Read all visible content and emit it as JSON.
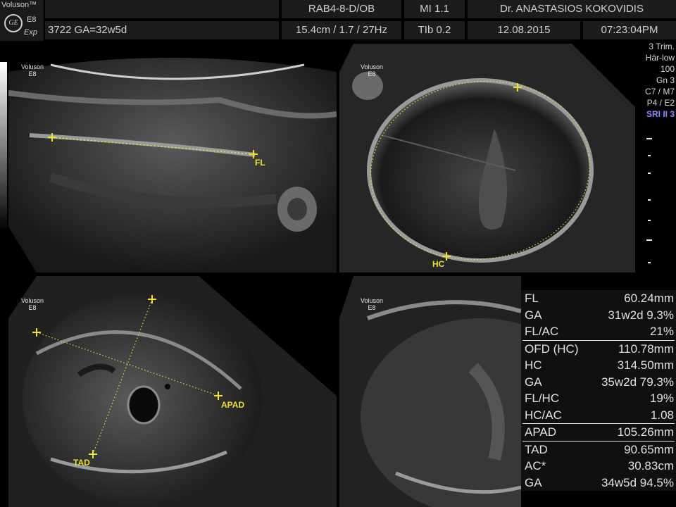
{
  "header": {
    "brand": "Voluson™",
    "logo_text": "GE",
    "model": "E8",
    "mode": "Exp",
    "patient_ga": "3722  GA=32w5d",
    "probe": "RAB4-8-D/OB",
    "mi": "MI  1.1",
    "doctor": "Dr. ANASTASIOS KOKOVIDIS",
    "depth_freq": "15.4cm / 1.7 / 27Hz",
    "tib": "TIb  0.2",
    "date": "12.08.2015",
    "time": "07:23:04PM"
  },
  "side_params": [
    "3 Trim.",
    "Här-low",
    "100",
    "Gn  3",
    "C7 / M7",
    "P4 / E2",
    "SRI II 3"
  ],
  "voluson_tag": {
    "line1": "Voluson",
    "line2": "E8"
  },
  "measure_labels": {
    "fl": "FL",
    "hc": "HC",
    "apad": "APAD",
    "tad": "TAD"
  },
  "measurements": [
    {
      "label": "FL",
      "value": "60.24mm"
    },
    {
      "label": "GA",
      "value": "31w2d  9.3%"
    },
    {
      "label": "FL/AC",
      "value": "21%"
    },
    {
      "label": "OFD (HC)",
      "value": "110.78mm"
    },
    {
      "label": "HC",
      "value": "314.50mm"
    },
    {
      "label": "GA",
      "value": "35w2d 79.3%"
    },
    {
      "label": "FL/HC",
      "value": "19%"
    },
    {
      "label": "HC/AC",
      "value": "1.08"
    },
    {
      "label": "APAD",
      "value": "105.26mm"
    },
    {
      "label": "TAD",
      "value": "90.65mm"
    },
    {
      "label": "AC*",
      "value": "30.83cm"
    },
    {
      "label": "GA",
      "value": "34w5d 94.5%"
    }
  ],
  "colors": {
    "caliper": "#f0e030",
    "header_bg": "#1c1c1c",
    "sri": "#8888ff"
  }
}
